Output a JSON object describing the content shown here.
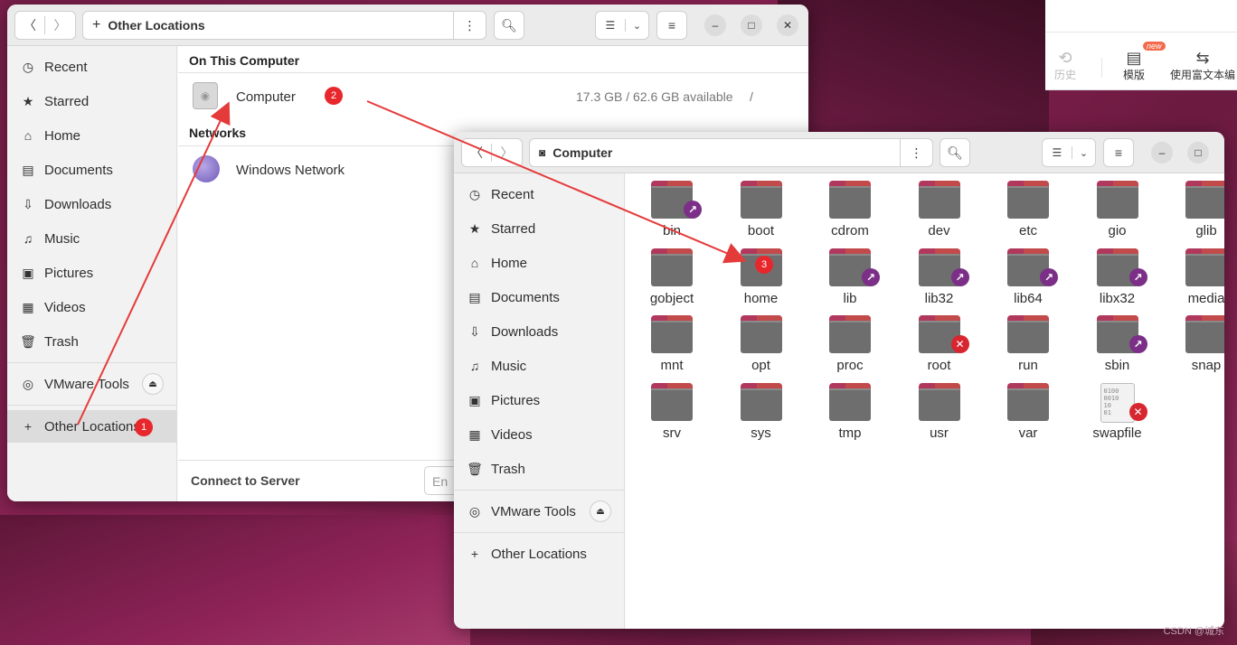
{
  "colors": {
    "accent": "#e95420",
    "badge": "#e8272d",
    "link_emblem": "#7b2f87",
    "arrow": "#e53a3a"
  },
  "side_app": {
    "tools": [
      {
        "icon": "history-icon",
        "label": "历史"
      },
      {
        "icon": "template-icon",
        "label": "模版",
        "badge": "new"
      },
      {
        "icon": "rich-text-icon",
        "label": "使用富文本编"
      }
    ]
  },
  "window_other": {
    "path": "Other Locations",
    "sidebar": [
      {
        "icon": "clock-icon",
        "label": "Recent"
      },
      {
        "icon": "star-icon",
        "label": "Starred"
      },
      {
        "icon": "home-icon",
        "label": "Home"
      },
      {
        "icon": "document-icon",
        "label": "Documents"
      },
      {
        "icon": "download-icon",
        "label": "Downloads"
      },
      {
        "icon": "music-icon",
        "label": "Music"
      },
      {
        "icon": "picture-icon",
        "label": "Pictures"
      },
      {
        "icon": "video-icon",
        "label": "Videos"
      },
      {
        "icon": "trash-icon",
        "label": "Trash"
      }
    ],
    "mount": "VMware Tools",
    "other_locations": "Other Locations",
    "section_computer": "On This Computer",
    "computer_name": "Computer",
    "computer_space": "17.3 GB / 62.6 GB available",
    "computer_path": "/",
    "section_networks": "Networks",
    "network_name": "Windows Network",
    "connect_label": "Connect to Server",
    "connect_placeholder": "En"
  },
  "window_computer": {
    "path": "Computer",
    "sidebar": [
      {
        "icon": "clock-icon",
        "label": "Recent"
      },
      {
        "icon": "star-icon",
        "label": "Starred"
      },
      {
        "icon": "home-icon",
        "label": "Home"
      },
      {
        "icon": "document-icon",
        "label": "Documents"
      },
      {
        "icon": "download-icon",
        "label": "Downloads"
      },
      {
        "icon": "music-icon",
        "label": "Music"
      },
      {
        "icon": "picture-icon",
        "label": "Pictures"
      },
      {
        "icon": "video-icon",
        "label": "Videos"
      },
      {
        "icon": "trash-icon",
        "label": "Trash"
      }
    ],
    "mount": "VMware Tools",
    "other_locations": "Other Locations",
    "items": [
      {
        "name": "bin",
        "emblem": "link"
      },
      {
        "name": "boot"
      },
      {
        "name": "cdrom"
      },
      {
        "name": "dev"
      },
      {
        "name": "etc"
      },
      {
        "name": "gio"
      },
      {
        "name": "glib"
      },
      {
        "name": "gobject"
      },
      {
        "name": "home"
      },
      {
        "name": "lib",
        "emblem": "link"
      },
      {
        "name": "lib32",
        "emblem": "link"
      },
      {
        "name": "lib64",
        "emblem": "link"
      },
      {
        "name": "libx32",
        "emblem": "link"
      },
      {
        "name": "media"
      },
      {
        "name": "mnt"
      },
      {
        "name": "opt"
      },
      {
        "name": "proc"
      },
      {
        "name": "root",
        "emblem": "lock"
      },
      {
        "name": "run"
      },
      {
        "name": "sbin",
        "emblem": "link"
      },
      {
        "name": "snap"
      },
      {
        "name": "srv"
      },
      {
        "name": "sys"
      },
      {
        "name": "tmp"
      },
      {
        "name": "usr"
      },
      {
        "name": "var"
      },
      {
        "name": "swapfile",
        "emblem": "lock",
        "file": true
      }
    ]
  },
  "annotations": [
    "1",
    "2",
    "3"
  ],
  "binary_glyph": "0100\n0010\n10\n01",
  "watermark": "CSDN @城东"
}
